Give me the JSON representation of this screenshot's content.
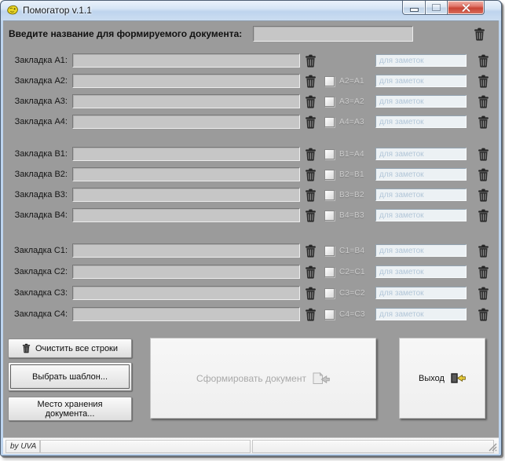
{
  "window": {
    "title": "Помогатор v.1.1",
    "controls": {
      "minimize": "minimize-window",
      "maximize": "maximize-window",
      "close": "close-window"
    }
  },
  "header": {
    "label": "Введите название для формируемого документа:",
    "document_name_value": ""
  },
  "rows": [
    {
      "key": "a1",
      "label": "Закладка A1:",
      "value": "",
      "notes_placeholder": "для заметок"
    },
    {
      "key": "a2",
      "label": "Закладка A2:",
      "checkbox_label": "A2=A1",
      "checked": false,
      "value": "",
      "notes_placeholder": "для заметок"
    },
    {
      "key": "a3",
      "label": "Закладка A3:",
      "checkbox_label": "A3=A2",
      "checked": false,
      "value": "",
      "notes_placeholder": "для заметок"
    },
    {
      "key": "a4",
      "label": "Закладка A4:",
      "checkbox_label": "A4=A3",
      "checked": false,
      "value": "",
      "notes_placeholder": "для заметок"
    },
    {
      "key": "b1",
      "label": "Закладка B1:",
      "checkbox_label": "B1=A4",
      "checked": false,
      "value": "",
      "notes_placeholder": "для заметок"
    },
    {
      "key": "b2",
      "label": "Закладка B2:",
      "checkbox_label": "B2=B1",
      "checked": false,
      "value": "",
      "notes_placeholder": "для заметок"
    },
    {
      "key": "b3",
      "label": "Закладка B3:",
      "checkbox_label": "B3=B2",
      "checked": false,
      "value": "",
      "notes_placeholder": "для заметок"
    },
    {
      "key": "b4",
      "label": "Закладка B4:",
      "checkbox_label": "B4=B3",
      "checked": false,
      "value": "",
      "notes_placeholder": "для заметок"
    },
    {
      "key": "c1",
      "label": "Закладка C1:",
      "checkbox_label": "C1=B4",
      "checked": false,
      "value": "",
      "notes_placeholder": "для заметок"
    },
    {
      "key": "c2",
      "label": "Закладка C2:",
      "checkbox_label": "C2=C1",
      "checked": false,
      "value": "",
      "notes_placeholder": "для заметок"
    },
    {
      "key": "c3",
      "label": "Закладка C3:",
      "checkbox_label": "C3=C2",
      "checked": false,
      "value": "",
      "notes_placeholder": "для заметок"
    },
    {
      "key": "c4",
      "label": "Закладка C4:",
      "checkbox_label": "C4=C3",
      "checked": false,
      "value": "",
      "notes_placeholder": "для заметок"
    }
  ],
  "footer": {
    "clear_all_label": "Очистить все строки",
    "choose_template_label": "Выбрать шаблон...",
    "storage_location_label": "Место хранения документа...",
    "generate_label": "Сформировать документ",
    "generate_enabled": false,
    "exit_label": "Выход"
  },
  "statusbar": {
    "credit": "by UVA"
  },
  "icons": {
    "app": "helper-app-icon",
    "trash": "trash-icon",
    "document_forward": "document-forward-icon",
    "exit": "exit-icon"
  },
  "colors": {
    "client_bg": "#9b9b9b",
    "titlebar_blue": "#bdd4ee",
    "close_red": "#c94435",
    "input_bg": "#c6c6c6",
    "notes_bg": "#ecf1f4",
    "notes_placeholder": "#b2c6d8",
    "disabled_text": "#a9a9a9"
  }
}
